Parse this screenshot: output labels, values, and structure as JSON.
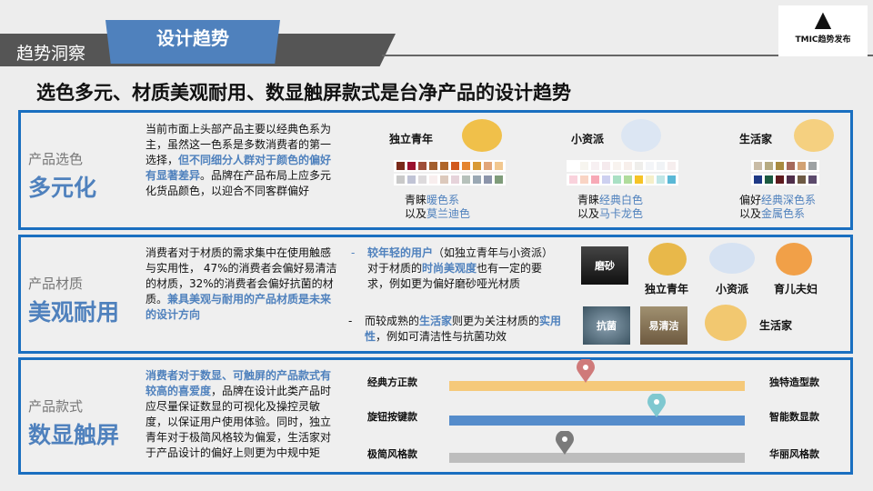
{
  "header": {
    "section": "趋势洞察",
    "tab": "设计趋势",
    "logo_text": "TMIC趋势发布"
  },
  "title": "选色多元、材质美观耐用、数显触屏款式是台净产品的设计趋势",
  "panels": [
    {
      "sub": "产品选色",
      "main": "多元化",
      "text": [
        "当前市面上头部产品主要以经典色系为主，虽然这一色系是多数消费者的第一选择，",
        "但不同细分人群对于颜色的偏好有显著差异",
        "。品牌在产品布局上应多元化货品颜色，以迎合不同客群偏好"
      ],
      "personas": [
        {
          "name": "独立青年",
          "cap1a": "青睐",
          "cap1b": "暖色系",
          "cap2a": "以及",
          "cap2b": "莫兰迪色",
          "row1": [
            "#7a2a1a",
            "#9b1230",
            "#a0503a",
            "#a46030",
            "#b0662a",
            "#d25a1e",
            "#e58530",
            "#d99a35",
            "#e2a67a",
            "#f2c890"
          ],
          "row2": [
            "#c9c9c9",
            "#c0c3d5",
            "#dddadc",
            "#f8eeee",
            "#dcc9bc",
            "#e6d3da",
            "#b6c1bb",
            "#9aa8b4",
            "#8b94aa",
            "#7f9c7a"
          ]
        },
        {
          "name": "小资派",
          "cap1a": "青睐",
          "cap1b": "经典白色",
          "cap2a": "以及",
          "cap2b": "马卡龙色",
          "row1": [
            "#ffffff",
            "#f7f5ef",
            "#f7f0f2",
            "#f5eaed",
            "#f8f3ef",
            "#f7efeb",
            "#efeeeb",
            "#f3f5f8",
            "#f0f3f6",
            "#f6eeee"
          ],
          "row2": [
            "#f9d2dc",
            "#f9d4c4",
            "#f7a9b6",
            "#cdd0f0",
            "#a9e0c4",
            "#b0dc9c",
            "#f6c325",
            "#f5efc9",
            "#bfe6e6",
            "#5ab8d6"
          ]
        },
        {
          "name": "生活家",
          "cap1a": "偏好",
          "cap1b": "经典深色系",
          "cap2a": "以及",
          "cap2b": "金属色系",
          "row1": [
            "#c9bca6",
            "#b7ab82",
            "#a98b40",
            "#a66a5c",
            "#d2a274",
            "#9ea2a4"
          ],
          "row2": [
            "#1f3a86",
            "#1b5a40",
            "#5e1a1e",
            "#4f2e4a",
            "#6e5a44",
            "#5c4a6c"
          ]
        }
      ]
    },
    {
      "sub": "产品材质",
      "main": "美观耐用",
      "text": [
        "消费者对于材质的需求集中在使用触感与实用性， 47%的消费者会偏好易清洁的材质，32%的消费者会偏好抗菌的材质。",
        "兼具美观与耐用的产品材质是未来的设计方向"
      ],
      "b1": [
        "较年轻的用户",
        "（如独立青年与小资派）对于材质的",
        "时尚美观度",
        "也有一定的要求，例如更为偏好磨砂哑光材质"
      ],
      "b2": [
        "而较成熟的",
        "生活家",
        "则更为关注材质的",
        "实用性",
        "，例如可清洁性与抗菌功效"
      ],
      "imgs": [
        "磨砂",
        "抗菌",
        "易清洁"
      ],
      "groups": [
        "独立青年",
        "小资派",
        "育儿夫妇",
        "生活家"
      ]
    },
    {
      "sub": "产品款式",
      "main": "数显触屏",
      "text": [
        "消费者对于数显、可触屏的产品款式有较高的喜爱度",
        "，品牌在设计此类产品时应尽量保证数显的可视化及操控灵敏度，以保证用户使用体验。同时，独立青年对于极简风格较为偏爱，生活家对于产品设计的偏好上则更为中规中矩"
      ],
      "scales": [
        {
          "left": "经典方正款",
          "right": "独特造型款",
          "position": 0.46,
          "bar_color": "#f5c97a",
          "pin_color": "#cf7a7a"
        },
        {
          "left": "旋钮按键款",
          "right": "智能数显款",
          "position": 0.7,
          "bar_color": "#558ccb",
          "pin_color": "#7fc8d0"
        },
        {
          "left": "极简风格款",
          "right": "华丽风格款",
          "position": 0.39,
          "bar_color": "#bdbdbd",
          "pin_color": "#7a7a7a"
        }
      ]
    }
  ],
  "colors": {
    "accent": "#4f81bd",
    "border": "#1a6fc0",
    "banner": "#555555"
  }
}
